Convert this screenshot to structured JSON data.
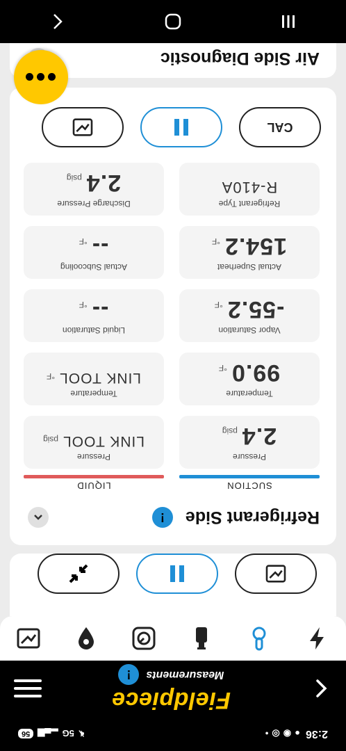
{
  "status_bar": {
    "time": "2:36",
    "network": "5G",
    "battery": "56"
  },
  "header": {
    "brand": "Fieldpiece",
    "subtitle": "Measurements"
  },
  "refrigerant_section": {
    "title": "Refrigerant Side",
    "suction_label": "SUCTION",
    "liquid_label": "LIQUID",
    "suction_color": "#1f8fd6",
    "liquid_color": "#e05a5a",
    "suction": [
      {
        "label": "Pressure",
        "value": "2.4",
        "unit": "psig"
      },
      {
        "label": "Temperature",
        "value": "99.0",
        "unit": "°F"
      },
      {
        "label": "Vapor Saturation",
        "value": "-55.2",
        "unit": "°F"
      },
      {
        "label": "Actual Superheat",
        "value": "154.2",
        "unit": "°F"
      },
      {
        "label": "Refrigerant Type",
        "value": "R-410A",
        "unit": ""
      }
    ],
    "liquid": [
      {
        "label": "Pressure",
        "value": "LINK TOOL",
        "unit": "psig"
      },
      {
        "label": "Temperature",
        "value": "LINK TOOL",
        "unit": "°F"
      },
      {
        "label": "Liquid Saturation",
        "value": "--",
        "unit": "°F"
      },
      {
        "label": "Actual Subcooling",
        "value": "--",
        "unit": "°F"
      },
      {
        "label": "Discharge Pressure",
        "value": "2.4",
        "unit": "psig"
      }
    ],
    "cal_label": "CAL"
  },
  "air_section": {
    "title": "Air Side Diagnostic"
  },
  "accent": "#ffc800"
}
